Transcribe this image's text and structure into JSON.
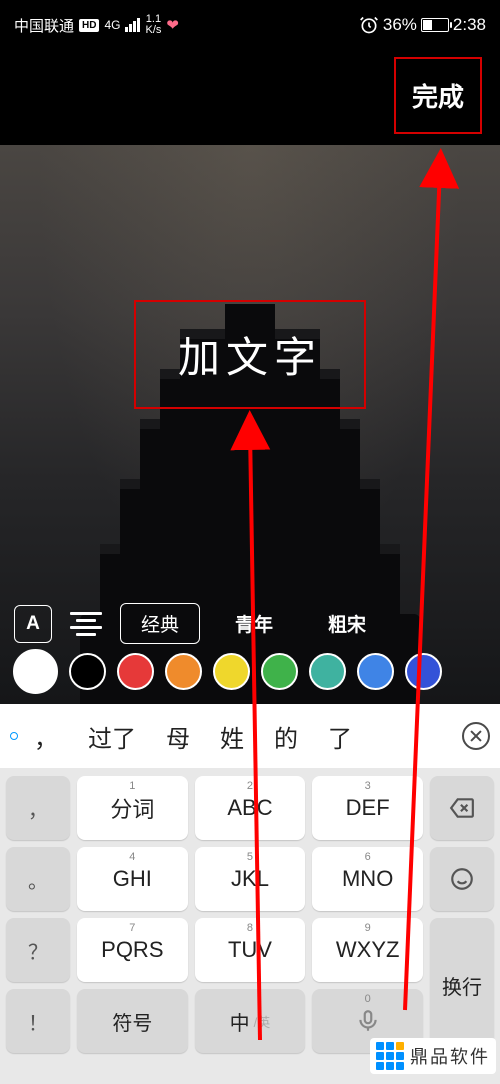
{
  "status": {
    "carrier": "中国联通",
    "hd": "HD",
    "network": "4G",
    "speed_top": "1.1",
    "speed_bot": "K/s",
    "alarm": "⏰",
    "battery_pct": "36%",
    "time": "2:38"
  },
  "toolbar": {
    "done": "完成"
  },
  "text_overlay": {
    "content": "加文字"
  },
  "style": {
    "icon_letter": "A",
    "fonts": [
      {
        "label": "经典",
        "selected": true
      },
      {
        "label": "青年",
        "selected": false
      },
      {
        "label": "粗宋",
        "selected": false
      }
    ]
  },
  "colors": [
    "#ffffff",
    "#000000",
    "#e63939",
    "#ef8b2c",
    "#efd72c",
    "#3fb24a",
    "#3fb2a0",
    "#3f84e6",
    "#3352d8"
  ],
  "candidates": [
    "，",
    "过了",
    "母",
    "姓",
    "的",
    "了"
  ],
  "keys": {
    "side_left": [
      "，",
      "。",
      "？",
      "！"
    ],
    "r1": [
      {
        "n": "1",
        "t": "分词"
      },
      {
        "n": "2",
        "t": "ABC"
      },
      {
        "n": "3",
        "t": "DEF"
      }
    ],
    "r2": [
      {
        "n": "4",
        "t": "GHI"
      },
      {
        "n": "5",
        "t": "JKL"
      },
      {
        "n": "6",
        "t": "MNO"
      }
    ],
    "r3": [
      {
        "n": "7",
        "t": "PQRS"
      },
      {
        "n": "8",
        "t": "TUV"
      },
      {
        "n": "9",
        "t": "WXYZ"
      }
    ],
    "r4_left": "符号",
    "r4_lang_main": "中",
    "r4_lang_sub": "/英",
    "r4_mic_num": "0",
    "r4_right": "换行"
  },
  "watermark": "鼎品软件"
}
